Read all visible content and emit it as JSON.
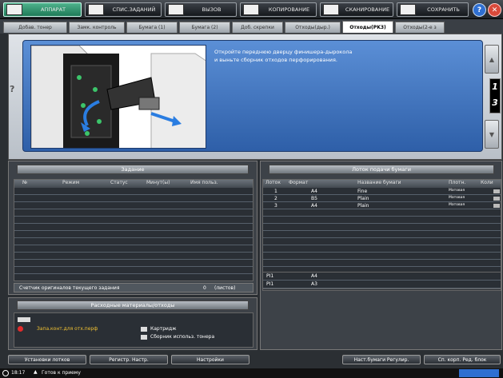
{
  "topbar": {
    "buttons": [
      {
        "label": "АППАРАТ",
        "active": true
      },
      {
        "label": "СПИС.ЗАДАНИЙ",
        "active": false
      },
      {
        "label": "ВЫЗОВ",
        "active": false
      },
      {
        "label": "КОПИРОВАНИЕ",
        "active": false
      },
      {
        "label": "СКАНИРОВАНИЕ",
        "active": false
      },
      {
        "label": "СОХРАНИТЬ",
        "active": false
      }
    ],
    "help_label": "?",
    "close_label": "✕"
  },
  "tabs": [
    "Добав. тонер",
    "Замк. контроль",
    "Бумага (1)",
    "Бумага (2)",
    "Доб. скрепки",
    "Отходы(дыр.)",
    "Отходы(PK3)",
    "Отходы(2-е з"
  ],
  "guide": {
    "instruction_line1": "Откройте переднюю дверцу финишера-дырокола",
    "instruction_line2": "и выньте сборник отходов перфорирования.",
    "page_current": "1",
    "page_total": "3",
    "help_label": "?"
  },
  "jobs_panel": {
    "title": "Задание",
    "columns": [
      "№",
      "Режим",
      "Статус",
      "Минут(ы)",
      "Имя польз."
    ],
    "counter_label": "Счетчик оригиналов текущего задания",
    "counter_value": "0",
    "counter_unit": "(листов)"
  },
  "consumables_panel": {
    "title": "Расходные материалы/отходы",
    "alert_text": "Запа.конт.для отх.перф",
    "item1": "Картридж",
    "item2": "Сборник использ. тонера"
  },
  "paper_panel": {
    "title": "Лоток подачи бумаги",
    "columns": [
      "Лоток",
      "Формат",
      "Название бумаги",
      "Плотн.",
      "Коли"
    ],
    "rows": [
      {
        "tray": "1",
        "size": "A4",
        "name": "Fine",
        "weight": "Матовая"
      },
      {
        "tray": "2",
        "size": "B5",
        "name": "Plain",
        "weight": "Матовая"
      },
      {
        "tray": "3",
        "size": "A4",
        "name": "Plain",
        "weight": "Матовая"
      }
    ],
    "output_rows": [
      {
        "tray": "PI1",
        "size": "A4"
      },
      {
        "tray": "PI1",
        "size": "A3"
      }
    ]
  },
  "bottom_buttons": [
    "Установки лотков",
    "Регистр. Настр.",
    "Настройки",
    "Наст.бумаги Регулир.",
    "Сп. корп. Ред. блок"
  ],
  "statusbar": {
    "time": "18:17",
    "message": "Готов к приему"
  },
  "colors": {
    "accent_green": "#1e7a57",
    "guide_blue": "#2e5fa8",
    "alert_red": "#e22b2b"
  }
}
